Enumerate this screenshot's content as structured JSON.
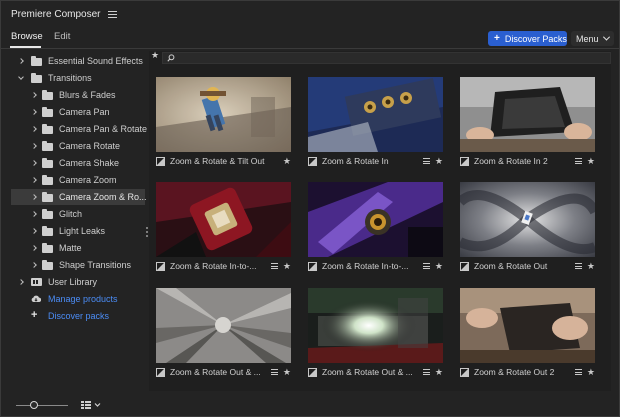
{
  "app": {
    "title": "Premiere Composer"
  },
  "tabs": [
    {
      "label": "Browse",
      "active": true
    },
    {
      "label": "Edit",
      "active": false
    }
  ],
  "header": {
    "discover_button": "Discover Packs",
    "menu_button": "Menu"
  },
  "colors": {
    "accent": "#2a5fd0",
    "link": "#4b8cf5"
  },
  "sidebar": {
    "items": [
      {
        "label": "Essential Sound Effects",
        "icon": "folder-icon",
        "expanded": false
      },
      {
        "label": "Transitions",
        "icon": "folder-icon",
        "expanded": true
      },
      {
        "label": "Blurs & Fades",
        "icon": "folder-icon"
      },
      {
        "label": "Camera Pan",
        "icon": "folder-icon"
      },
      {
        "label": "Camera Pan & Rotate",
        "icon": "folder-icon"
      },
      {
        "label": "Camera Rotate",
        "icon": "folder-icon"
      },
      {
        "label": "Camera Shake",
        "icon": "folder-icon"
      },
      {
        "label": "Camera Zoom",
        "icon": "folder-icon"
      },
      {
        "label": "Camera Zoom & Ro...",
        "icon": "folder-icon",
        "selected": true
      },
      {
        "label": "Glitch",
        "icon": "folder-icon"
      },
      {
        "label": "Light Leaks",
        "icon": "folder-icon"
      },
      {
        "label": "Matte",
        "icon": "folder-icon"
      },
      {
        "label": "Shape Transitions",
        "icon": "folder-icon"
      },
      {
        "label": "User Library",
        "icon": "library-icon"
      },
      {
        "label": "Manage products",
        "icon": "cloud-download-icon"
      },
      {
        "label": "Discover packs",
        "icon": "plus-icon"
      }
    ]
  },
  "grid": {
    "items": [
      {
        "label": "Zoom & Rotate & Tilt Out"
      },
      {
        "label": "Zoom & Rotate In"
      },
      {
        "label": "Zoom & Rotate In 2"
      },
      {
        "label": "Zoom & Rotate In-to-..."
      },
      {
        "label": "Zoom & Rotate In-to-..."
      },
      {
        "label": "Zoom & Rotate Out"
      },
      {
        "label": "Zoom & Rotate Out & ..."
      },
      {
        "label": "Zoom & Rotate Out & ..."
      },
      {
        "label": "Zoom & Rotate Out 2"
      }
    ]
  },
  "footer": {
    "zoom_level": 0.35
  }
}
